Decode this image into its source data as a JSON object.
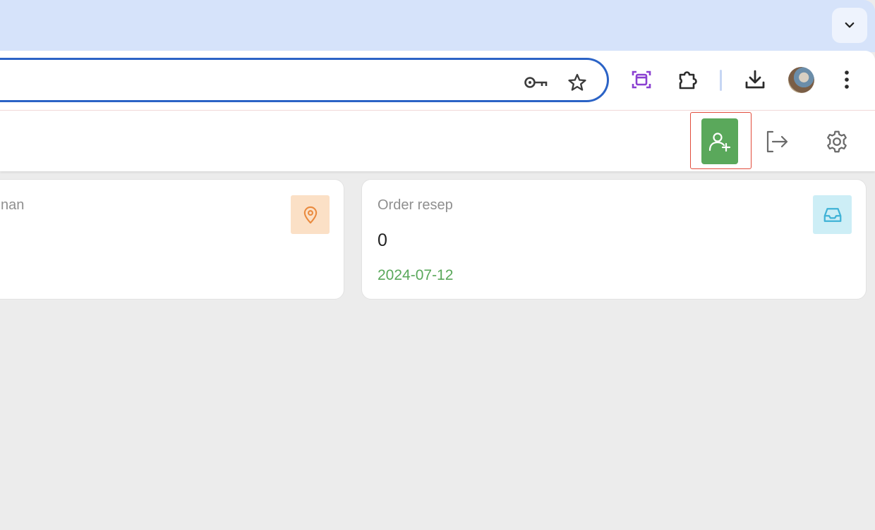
{
  "browser": {
    "tab_dropdown_icon": "chevron-down-icon",
    "omnibox_icons": [
      "key-icon",
      "star-icon"
    ],
    "toolbar_icons": [
      "screenshot-icon",
      "extensions-puzzle-icon",
      "download-icon",
      "avatar",
      "more-vert-icon"
    ],
    "accent": "#2b63c6",
    "tabstrip_color": "#d6e3fa"
  },
  "app_header": {
    "icons": [
      "add-user-icon",
      "logout-icon",
      "settings-gear-icon"
    ],
    "add_user_color": "#5aa85b",
    "highlight_color": "#e14b3b"
  },
  "cards": [
    {
      "title": "nan",
      "icon": "map-pin-icon",
      "icon_bg": "#fbe0c6",
      "icon_color": "#ea8a3e"
    },
    {
      "title": "Order resep",
      "value": "0",
      "date": "2024-07-12",
      "icon": "inbox-icon",
      "icon_bg": "#cdeef6",
      "icon_color": "#3fb2d6"
    }
  ]
}
